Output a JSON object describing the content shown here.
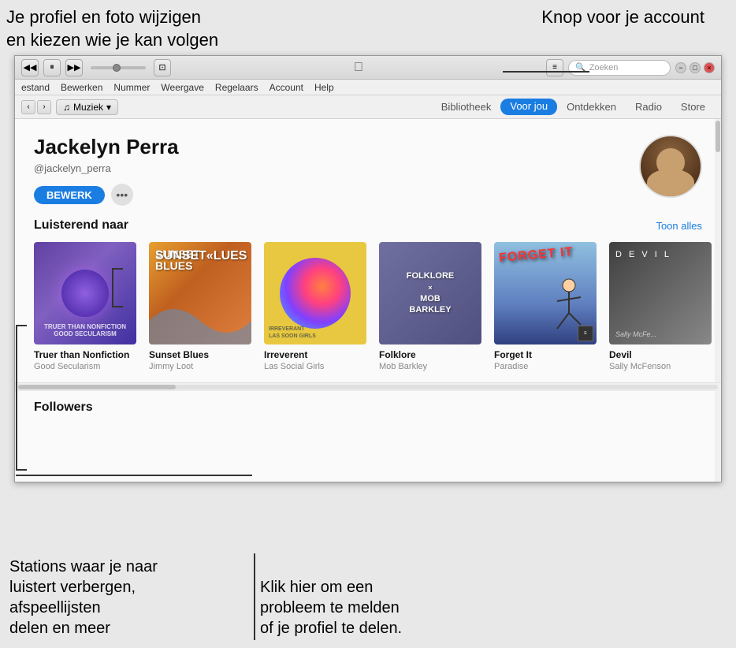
{
  "annotations": {
    "topleft_line1": "Je profiel en foto wijzigen",
    "topleft_line2": "en kiezen wie je kan volgen",
    "topright": "Knop voor je account",
    "bottomleft_line1": "Stations waar je naar",
    "bottomleft_line2": "luistert verbergen,",
    "bottomleft_line3": "afspeellijsten",
    "bottomleft_line4": "delen en meer",
    "bottomright_line1": "Klik hier om een",
    "bottomright_line2": "probleem te melden",
    "bottomright_line3": "of je profiel te delen."
  },
  "titlebar": {
    "rewind_label": "◀◀",
    "play_label": "⏸",
    "forward_label": "▶▶",
    "airplay_label": "⊡",
    "list_view_label": "≡",
    "search_placeholder": "Zoeken",
    "minimize_label": "−",
    "maximize_label": "□",
    "close_label": "×"
  },
  "menubar": {
    "items": [
      "estand",
      "Bewerken",
      "Nummer",
      "Weergave",
      "Regelaars",
      "Account",
      "Help"
    ]
  },
  "navbar": {
    "back_label": "‹",
    "forward_label": "›",
    "source_icon": "♫",
    "source_label": "Muziek",
    "tabs": [
      {
        "label": "Bibliotheek",
        "active": false
      },
      {
        "label": "Voor jou",
        "active": true
      },
      {
        "label": "Ontdekken",
        "active": false
      },
      {
        "label": "Radio",
        "active": false
      },
      {
        "label": "Store",
        "active": false
      }
    ]
  },
  "profile": {
    "name": "Jackelyn Perra",
    "handle": "@jackelyn_perra",
    "edit_label": "BEWERK",
    "more_label": "•••"
  },
  "listening_section": {
    "title": "Luisterend naar",
    "show_all_label": "Toon alles",
    "albums": [
      {
        "title": "Truer than Nonfiction",
        "artist": "Good Secularism",
        "cover_type": "truer"
      },
      {
        "title": "Sunset Blues",
        "artist": "Jimmy Loot",
        "cover_type": "sunset"
      },
      {
        "title": "Irreverent",
        "artist": "Las Social Girls",
        "cover_type": "irreverent"
      },
      {
        "title": "Folklore",
        "artist": "Mob Barkley",
        "cover_type": "folklore"
      },
      {
        "title": "Forget It",
        "artist": "Paradise",
        "cover_type": "forget"
      },
      {
        "title": "Devil",
        "artist": "Sally McFenson",
        "cover_type": "devil"
      }
    ]
  },
  "followers": {
    "title": "Followers"
  }
}
